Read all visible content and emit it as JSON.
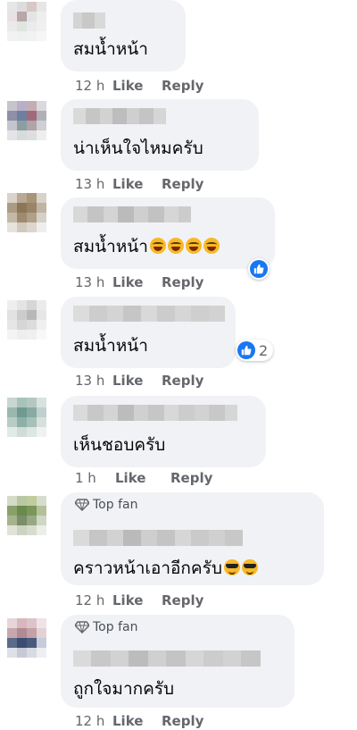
{
  "comments": [
    {
      "text": "สมน้ำหน้า",
      "time": "12 h",
      "like": "Like",
      "reply": "Reply"
    },
    {
      "text": "น่าเห็นใจไหมครับ",
      "time": "13 h",
      "like": "Like",
      "reply": "Reply"
    },
    {
      "text": "สมน้ำหน้า",
      "time": "13 h",
      "like": "Like",
      "reply": "Reply",
      "emoji": "laughing-face x4",
      "reactions": {
        "icon": "like-icon"
      }
    },
    {
      "text": "สมน้ำหน้า",
      "time": "13 h",
      "like": "Like",
      "reply": "Reply",
      "reactions": {
        "icon": "like-icon",
        "count": "2"
      }
    },
    {
      "text": "เห็นชอบครับ",
      "time": "1 h",
      "like": "Like",
      "reply": "Reply"
    },
    {
      "badge": "Top fan",
      "text": "คราวหน้าเอาอีกครับ",
      "time": "12 h",
      "like": "Like",
      "reply": "Reply",
      "emoji": "sunglasses-face x2"
    },
    {
      "badge": "Top fan",
      "text": "ถูกใจมากครับ",
      "time": "12 h",
      "like": "Like",
      "reply": "Reply"
    }
  ],
  "colors": {
    "bubble": "#f0f2f5",
    "meta": "#65676b",
    "like_blue": "#1877f2"
  }
}
